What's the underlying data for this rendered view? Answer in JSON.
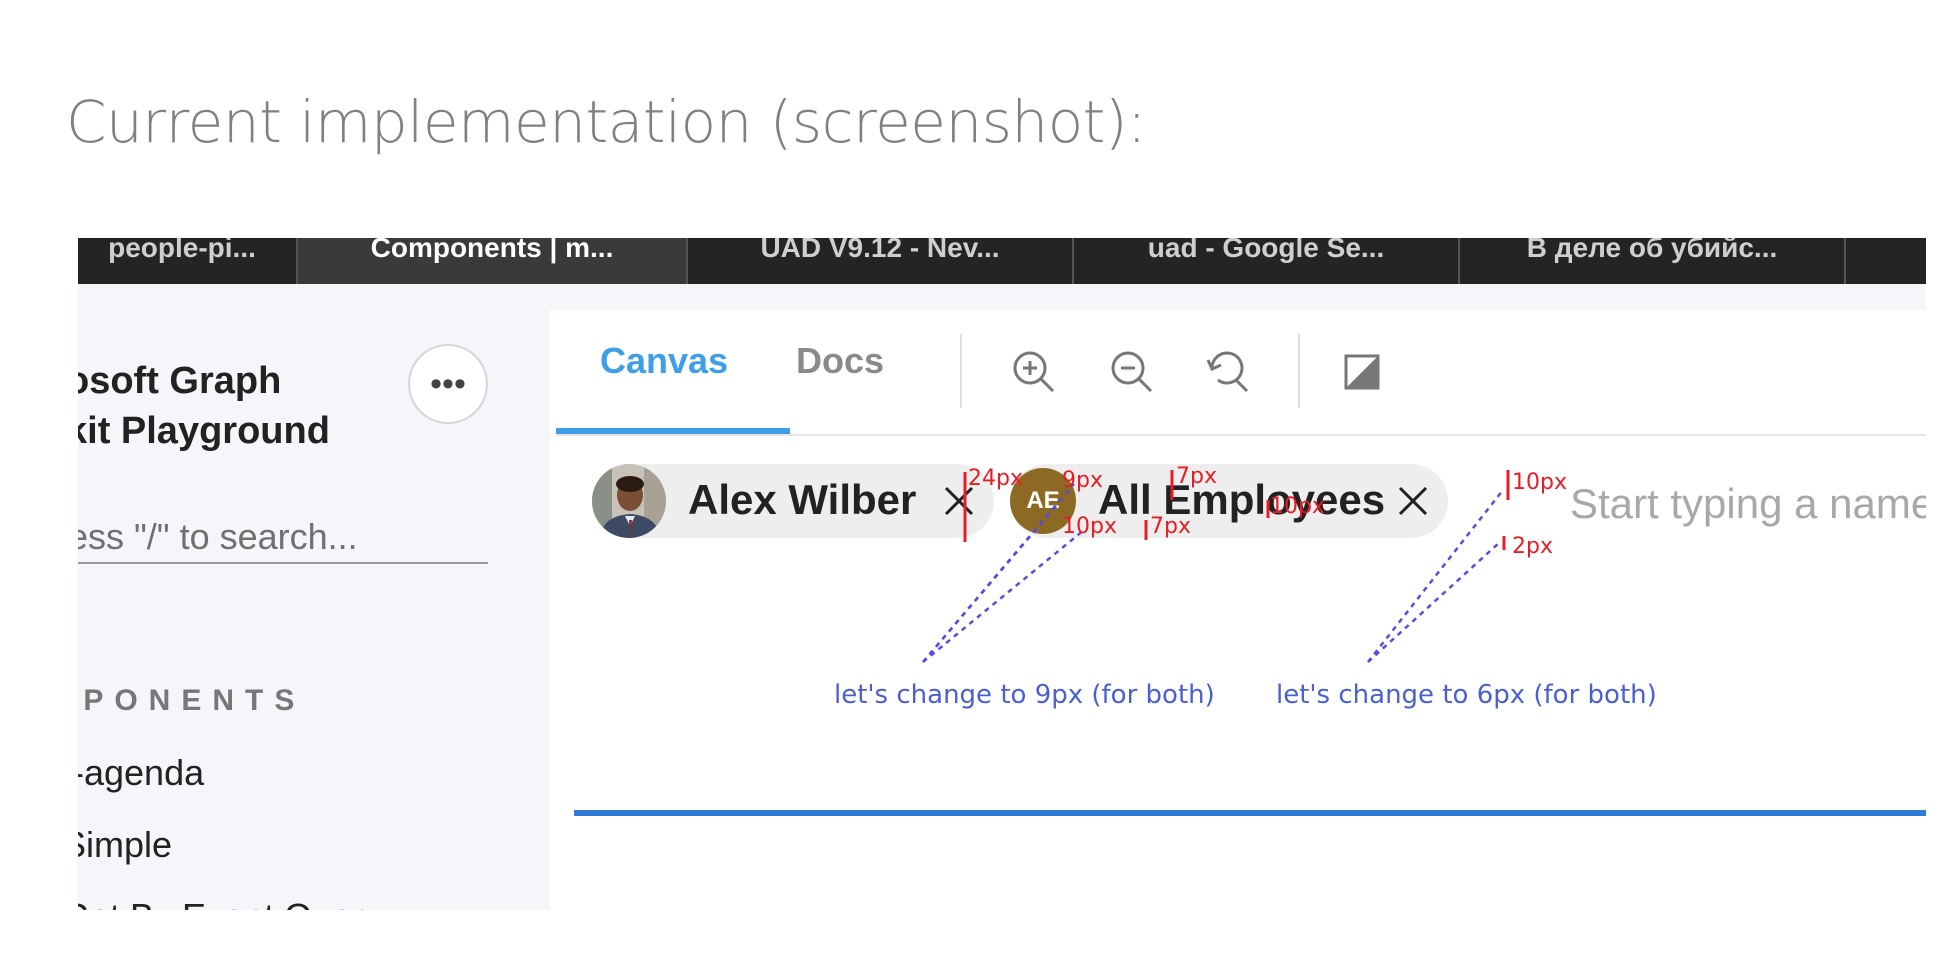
{
  "heading": "Current implementation (screenshot):",
  "browser_tabs": [
    {
      "label": "people-pi...",
      "active": false
    },
    {
      "label": "Components | m...",
      "active": true
    },
    {
      "label": "UAD V9.12 - Nev...",
      "active": false
    },
    {
      "label": "uad - Google Se...",
      "active": false
    },
    {
      "label": "В деле об убийс...",
      "active": false
    }
  ],
  "sidebar": {
    "title_line1": "osoft Graph",
    "title_line2": "kit Playground",
    "more_label": "•••",
    "search_placeholder": "ess \"/\" to search...",
    "section_label": "IPONENTS",
    "items": [
      "t-agenda",
      "Simple",
      "Get By Event Query"
    ]
  },
  "panel": {
    "tabs": [
      {
        "label": "Canvas",
        "active": true
      },
      {
        "label": "Docs",
        "active": false
      }
    ],
    "toolbar": [
      "zoom-in-icon",
      "zoom-out-icon",
      "reset-zoom-icon",
      "toggle-background-icon"
    ],
    "people_picker": {
      "chips": [
        {
          "name": "Alex Wilber",
          "avatar": "photo"
        },
        {
          "name": "All Employees",
          "initials": "AE",
          "avatar_color": "#8c6a24"
        }
      ],
      "input_placeholder": "Start typing a name",
      "accent_color": "#2f7ad6"
    }
  },
  "annotations": {
    "measurements": [
      "24px",
      "9px",
      "10px",
      "7px",
      "7px",
      "10px",
      "10px",
      "2px"
    ],
    "notes": [
      "let's change to 9px (for both)",
      "let's change to 6px (for both)"
    ],
    "color_measure": "#e81c24",
    "color_note": "#4a5fd0"
  }
}
